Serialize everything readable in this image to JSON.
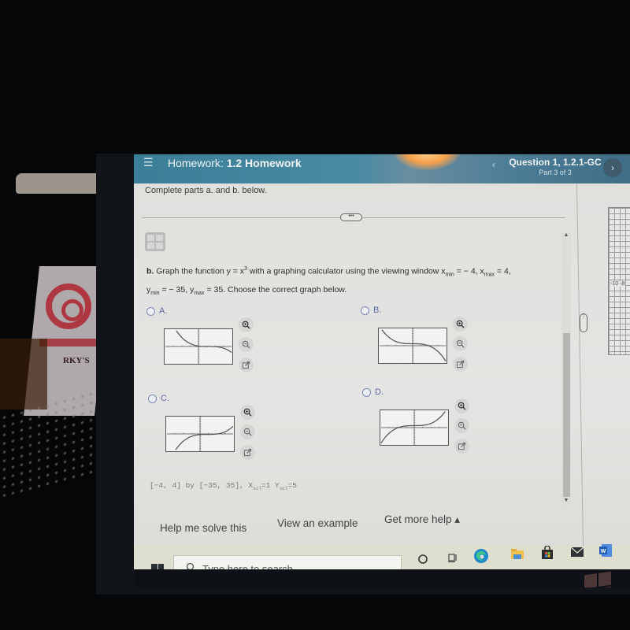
{
  "header": {
    "menu_icon": "hamburger-menu-icon",
    "title_prefix": "Homework:",
    "title": "1.2 Homework",
    "question_title": "Question 1, 1.2.1-GC",
    "question_part": "Part 3 of 3",
    "prev_glyph": "‹",
    "next_glyph": "›"
  },
  "instructions": "Complete parts a. and b. below.",
  "more_handle": "•••",
  "side_panel": {
    "grid_label": "-10 -8",
    "handle": "⋮"
  },
  "question": {
    "part_label": "b.",
    "text_1": "Graph the function y = x",
    "exponent": "3",
    "text_2": "with a graphing calculator using the viewing window x",
    "xmin_sub": "min",
    "xmin_val": "= − 4, x",
    "xmax_sub": "max",
    "xmax_val": "= 4,",
    "ymin_prefix": "y",
    "ymin_sub": "min",
    "ymin_val": "= − 35, y",
    "ymax_sub": "max",
    "ymax_val": "= 35. Choose the correct graph below."
  },
  "options": [
    {
      "label": "A.",
      "curve": "decreasing-shifted",
      "selected": false
    },
    {
      "label": "B.",
      "curve": "decreasing-cubic",
      "selected": false
    },
    {
      "label": "C.",
      "curve": "increasing-shifted",
      "selected": false
    },
    {
      "label": "D.",
      "curve": "increasing-cubic",
      "selected": false
    }
  ],
  "option_icons": {
    "zoom_in": "zoom-in-icon",
    "zoom_out": "zoom-out-icon",
    "popout": "open-new-window-icon"
  },
  "window_note": {
    "range": "[−4, 4] by [−35, 35], X",
    "xscl_sub": "scl",
    "xscl_val": "=1 Y",
    "yscl_sub": "scl",
    "yscl_val": "=5"
  },
  "help": {
    "solve": "Help me solve this",
    "example": "View an example",
    "more": "Get more help ▴"
  },
  "taskbar": {
    "search_placeholder": "Type here to search",
    "icons": [
      "windows-start-icon",
      "cortana-icon",
      "task-view-icon",
      "edge-icon",
      "file-explorer-icon",
      "store-icon",
      "mail-icon",
      "word-icon"
    ]
  },
  "scroll": {
    "up": "▲",
    "down": "▼"
  }
}
